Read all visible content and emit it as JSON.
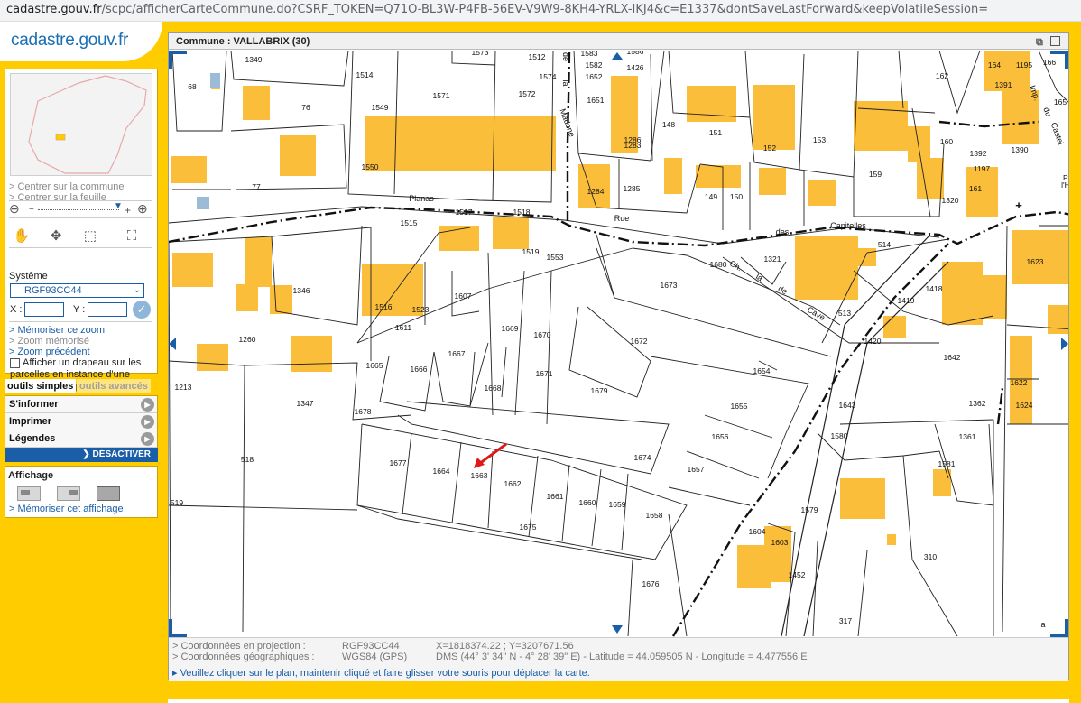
{
  "browser": {
    "url_domain": "cadastre.gouv.fr",
    "url_path": "/scpc/afficherCarteCommune.do?CSRF_TOKEN=Q71O-BL3W-P4FB-56EV-V9W9-8KH4-YRLX-IKJ4&c=E1337&dontSaveLastForward&keepVolatileSession="
  },
  "logo": {
    "text": "cadastre.gouv.fr"
  },
  "leftpanel": {
    "center_commune": "> Centrer sur la commune",
    "center_sheet": "> Centrer sur la feuille",
    "system_label": "Système",
    "system_value": "RGF93CC44",
    "x_label": "X :",
    "y_label": "Y :",
    "memorize_zoom": "> Mémoriser ce zoom",
    "memorized_zoom": "> Zoom mémorisé",
    "previous_zoom": "> Zoom précédent",
    "flag_label": "Afficher un drapeau sur les parcelles en instance d'une mise à jour graphique"
  },
  "tabs": {
    "simple": "outils simples",
    "advanced": "outils avancés"
  },
  "tools": {
    "inform": "S'informer",
    "print": "Imprimer",
    "legends": "Légendes",
    "deactivate": "DÉSACTIVER"
  },
  "affichage": {
    "title": "Affichage",
    "memorize": "> Mémoriser cet affichage"
  },
  "map": {
    "title": "Commune : VALLABRIX (30)",
    "parcels": [
      "1573",
      "1512",
      "1583",
      "1586",
      "1582",
      "1426",
      "1652",
      "1574",
      "1349",
      "68",
      "1514",
      "76",
      "1549",
      "1571",
      "1572",
      "1651",
      "1286",
      "1283",
      "148",
      "151",
      "152",
      "153",
      "159",
      "162",
      "1391",
      "164",
      "1195",
      "166",
      "165",
      "160",
      "1390",
      "1392",
      "1197",
      "1320",
      "161",
      "1550",
      "77",
      "1284",
      "1285",
      "149",
      "150",
      "1515",
      "1517",
      "1518",
      "514",
      "1623",
      "1519",
      "1553",
      "1346",
      "1607",
      "1680",
      "1321",
      "1673",
      "1418",
      "1419",
      "1516",
      "1523",
      "1611",
      "1669",
      "1670",
      "1672",
      "513",
      "1420",
      "1260",
      "1665",
      "1666",
      "1667",
      "1642",
      "1671",
      "1654",
      "1213",
      "1347",
      "1668",
      "1679",
      "1643",
      "1362",
      "1622",
      "1624",
      "1678",
      "1655",
      "1580",
      "1361",
      "1656",
      "1677",
      "1664",
      "1663",
      "1662",
      "1674",
      "1657",
      "1581",
      "518",
      "1661",
      "1660",
      "1659",
      "1658",
      "1579",
      "519",
      "1675",
      "1604",
      "1603",
      "1452",
      "310",
      "1676",
      "317",
      "PI",
      "l'H"
    ],
    "street_labels": [
      "Planas",
      "Rue",
      "des",
      "Capitelles",
      "Ch.",
      "la",
      "de",
      "Cave",
      "de",
      "la",
      "Madone",
      "Imp.",
      "du",
      "Castel",
      "a"
    ]
  },
  "coords": {
    "proj_label": "> Coordonnées en projection :",
    "proj_system": "RGF93CC44",
    "proj_value": "X=1818374.22 ; Y=3207671.56",
    "geo_label": "> Coordonnées géographiques :",
    "geo_system": "WGS84 (GPS)",
    "geo_value": "DMS (44° 3' 34\" N - 4° 28' 39\" E) - Latitude = 44.059505 N - Longitude = 4.477556 E",
    "hint": "▸ Veuillez cliquer sur le plan, maintenir cliqué et faire glisser votre souris pour déplacer la carte."
  }
}
